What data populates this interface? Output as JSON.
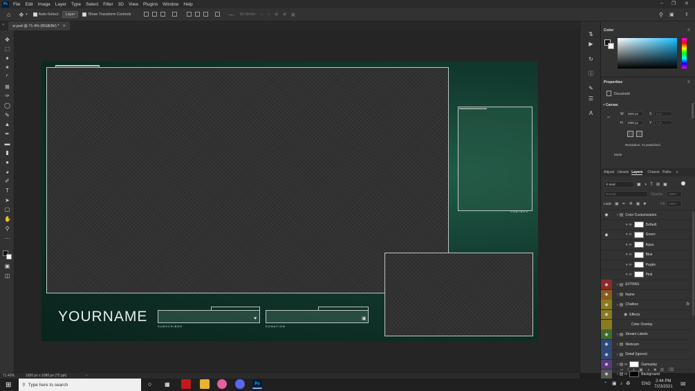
{
  "menubar": {
    "app_logo": "Ps",
    "items": [
      "File",
      "Edit",
      "Image",
      "Layer",
      "Type",
      "Select",
      "Filter",
      "3D",
      "View",
      "Plugins",
      "Window",
      "Help"
    ]
  },
  "options": {
    "auto_select_label": "Auto-Select:",
    "auto_select_value": "Layer",
    "show_transform_label": "Show Transform Controls",
    "mode_3d_label": "3D Mode:"
  },
  "doc": {
    "tab_title": "sr.psd @ 71.4% (RGB/8#) *",
    "zoom": "71.42%",
    "dims": "1920 px x 1080 px (72 ppi)"
  },
  "artboard": {
    "yourname": "YOURNAME",
    "subscriber_label": "SUBSCRIBER",
    "donation_label": "DONATION",
    "chatbox_label": "CHATBOX"
  },
  "color_panel": {
    "title": "Color"
  },
  "properties": {
    "title": "Properties",
    "doc_label": "Document",
    "canvas_label": "Canvas",
    "w_label": "W",
    "w_value": "1920 px",
    "h_label": "H",
    "h_value": "1080 px",
    "x_label": "X",
    "x_value": "0 px",
    "y_label": "Y",
    "y_value": "0 px",
    "resolution": "Resolution: 72 pixels/inch",
    "mode_label": "Mode"
  },
  "layers_panel": {
    "tabs": [
      "Adjustr",
      "Librarie",
      "Layers",
      "Channe",
      "Paths"
    ],
    "active_tab": "Layers",
    "kind": "Kind",
    "blend": "Normal",
    "opacity_label": "Opacity:",
    "opacity_value": "100%",
    "lock_label": "Lock:",
    "fill_label": "Fill:",
    "fill_value": "100%",
    "rows": [
      {
        "name": "Color Customization",
        "kind": "group",
        "eye": true,
        "color": ""
      },
      {
        "name": "Default",
        "kind": "adjust",
        "eye": false,
        "color": ""
      },
      {
        "name": "Green",
        "kind": "adjust",
        "eye": true,
        "color": ""
      },
      {
        "name": "Aqua",
        "kind": "adjust",
        "eye": false,
        "color": ""
      },
      {
        "name": "Blue",
        "kind": "adjust",
        "eye": false,
        "color": ""
      },
      {
        "name": "Purple",
        "kind": "adjust",
        "eye": false,
        "color": ""
      },
      {
        "name": "Pink",
        "kind": "adjust",
        "eye": false,
        "color": ""
      },
      {
        "name": "EXTRAS",
        "kind": "group",
        "eye": true,
        "color": "#8b2a2a"
      },
      {
        "name": "Name",
        "kind": "group",
        "eye": true,
        "color": "#8b5a1e"
      },
      {
        "name": "Chatbox",
        "kind": "group",
        "eye": true,
        "color": "#8b7a1e",
        "fx": "fx"
      },
      {
        "name": "Effects",
        "kind": "effect",
        "eye": true,
        "color": "#8b7a1e"
      },
      {
        "name": "Color Overlay",
        "kind": "effect2",
        "eye": false,
        "color": "#8b7a1e"
      },
      {
        "name": "Stream Labels",
        "kind": "group",
        "eye": true,
        "color": "#3f6b2f"
      },
      {
        "name": "Webcam",
        "kind": "group",
        "eye": true,
        "color": "#2f4a7a"
      },
      {
        "name": "Detail (Ignore)",
        "kind": "group",
        "eye": true,
        "color": "#2f4a7a"
      },
      {
        "name": "Gameplay",
        "kind": "smart",
        "eye": true,
        "color": "#5a3a7a"
      },
      {
        "name": "Background",
        "kind": "smartblack",
        "eye": true,
        "color": "#555555"
      }
    ]
  },
  "taskbar": {
    "search_placeholder": "Type here to search",
    "lang": "ENG",
    "time": "2:44 PM",
    "date": "7/23/2021"
  },
  "colors": {
    "accent_green": "#0f3a2e",
    "frame_stroke": "#bfc9c5"
  }
}
